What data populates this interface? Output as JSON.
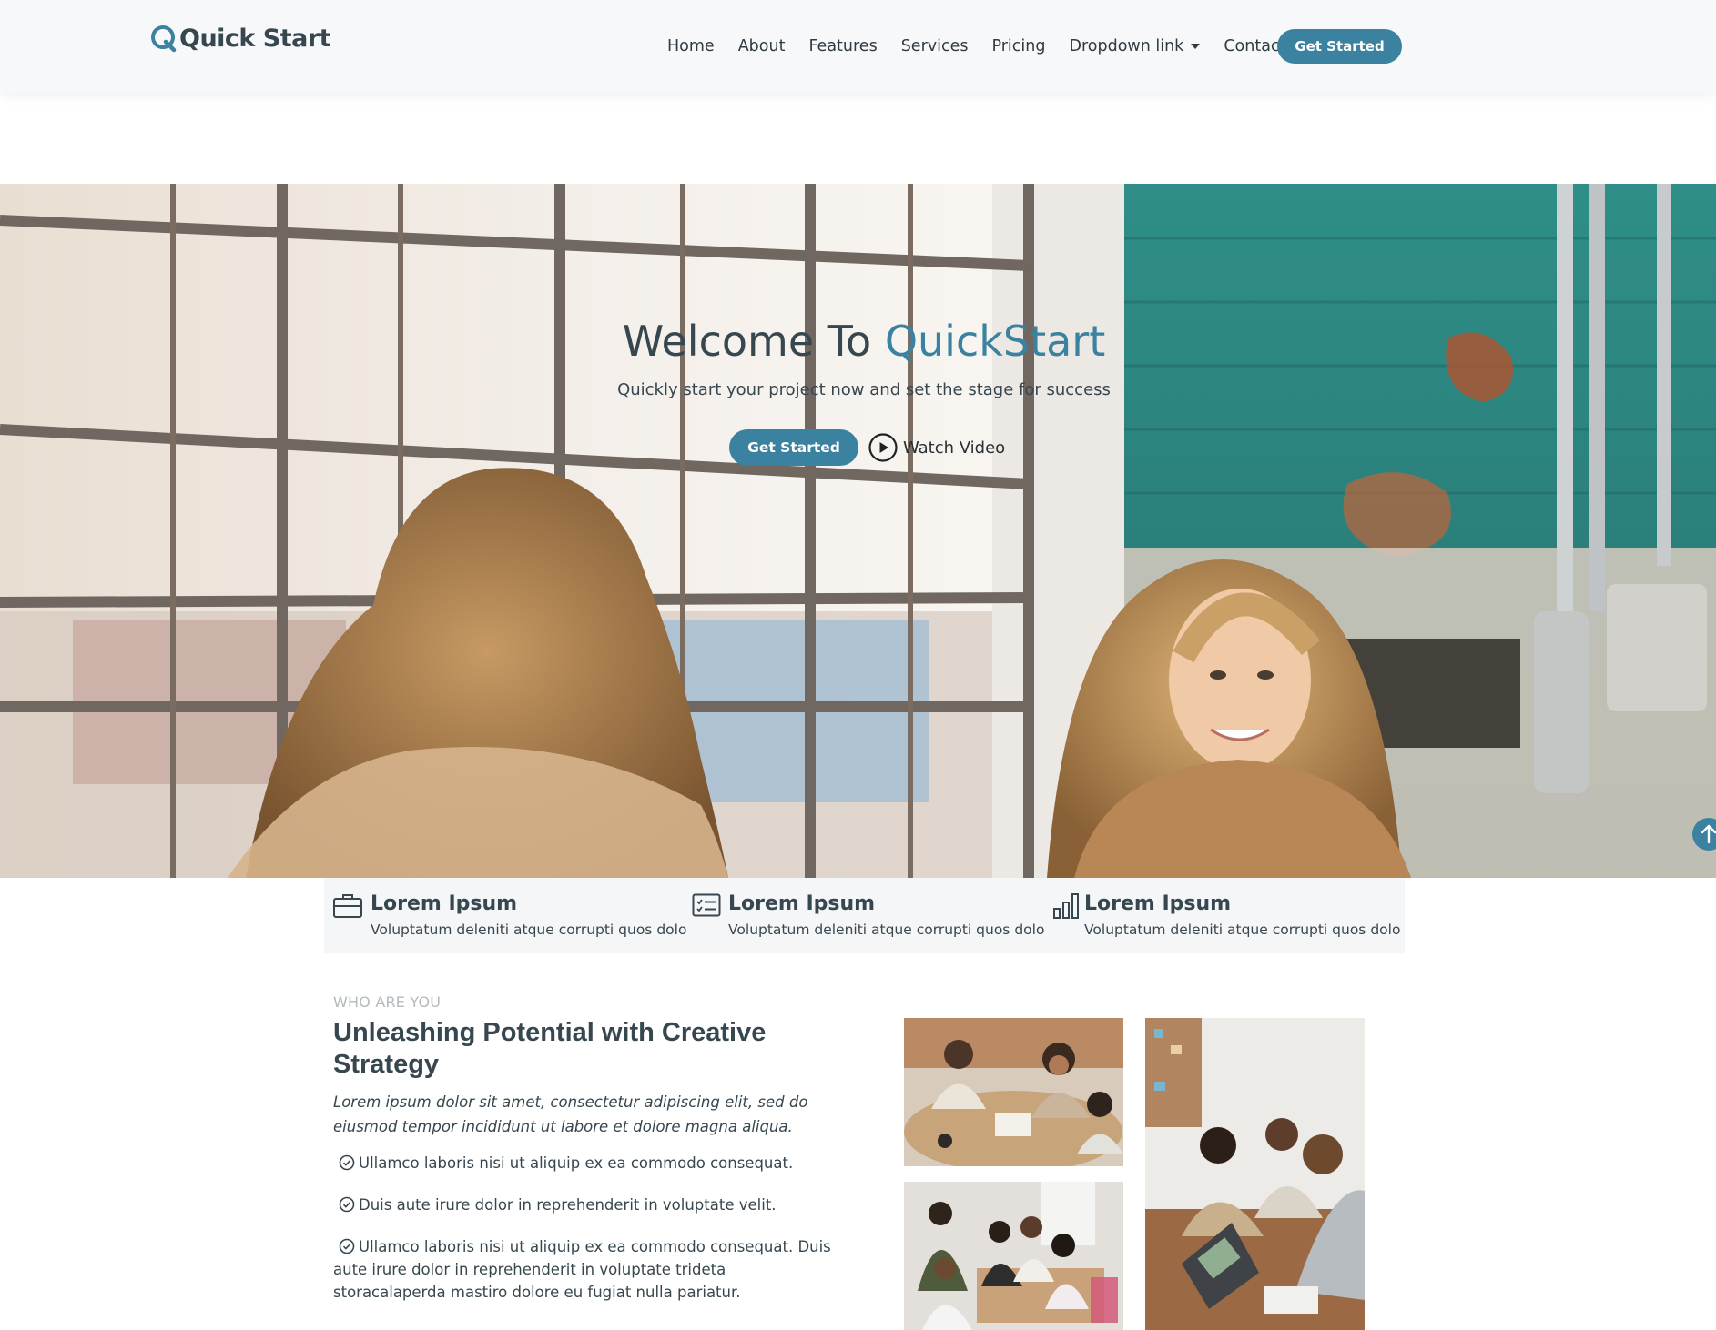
{
  "header": {
    "logo_text": "Quick Start",
    "nav": [
      "Home",
      "About",
      "Features",
      "Services",
      "Pricing",
      "Dropdown link",
      "Contact"
    ],
    "cta_label": "Get Started"
  },
  "hero": {
    "title_prefix": "Welcome To ",
    "title_accent": "QuickStart",
    "subtitle": "Quickly start your project now and set the stage for success",
    "cta_label": "Get Started",
    "video_label": "Watch Video"
  },
  "features": [
    {
      "icon": "briefcase-icon",
      "title": "Lorem Ipsum",
      "desc": "Voluptatum deleniti atque corrupti quos dolo"
    },
    {
      "icon": "card-checklist-icon",
      "title": "Lorem Ipsum",
      "desc": "Voluptatum deleniti atque corrupti quos dolo"
    },
    {
      "icon": "bar-chart-icon",
      "title": "Lorem Ipsum",
      "desc": "Voluptatum deleniti atque corrupti quos dolo"
    }
  ],
  "about": {
    "label": "WHO ARE YOU",
    "title": "Unleashing Potential with Creative Strategy",
    "lead": "Lorem ipsum dolor sit amet, consectetur adipiscing elit, sed do eiusmod tempor incididunt ut labore et dolore magna aliqua.",
    "items": [
      "Ullamco laboris nisi ut aliquip ex ea commodo consequat.",
      "Duis aute irure dolor in reprehenderit in voluptate velit.",
      "Ullamco laboris nisi ut aliquip ex ea commodo consequat. Duis aute irure dolor in reprehenderit in voluptate trideta storacalaperda mastiro dolore eu fugiat nulla pariatur."
    ]
  },
  "colors": {
    "accent": "#3b82a0",
    "heading": "#37474f",
    "header_bg": "#f7f8f9",
    "strip_bg": "#f5f6f8"
  }
}
